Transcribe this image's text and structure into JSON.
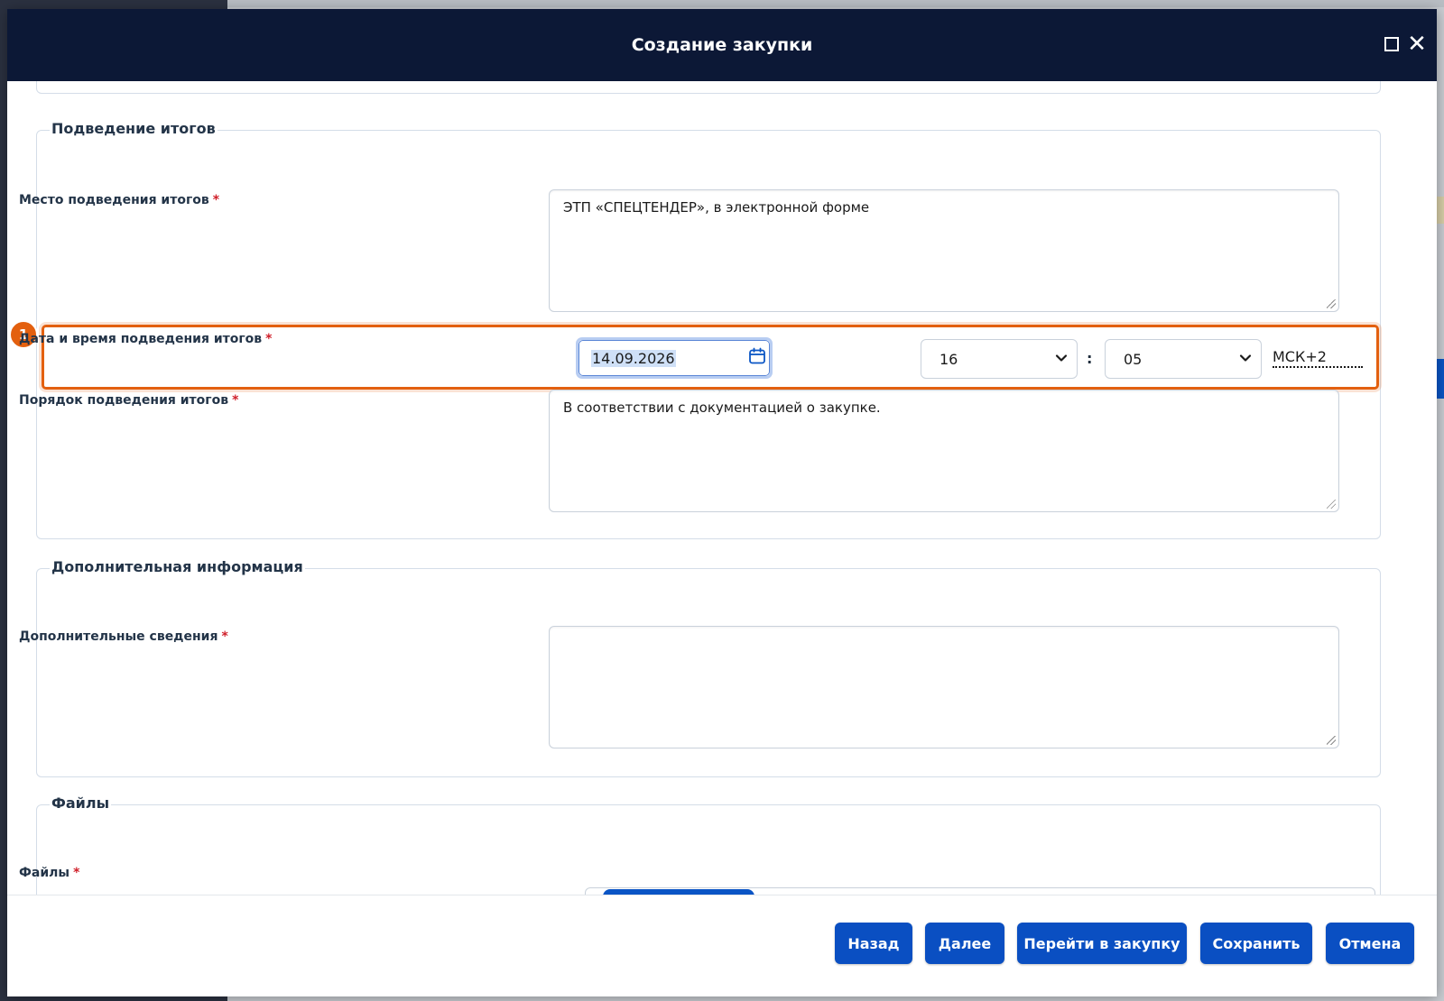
{
  "modal": {
    "title": "Создание закупки",
    "maximize_icon": "maximize-icon",
    "close_icon": "close-icon"
  },
  "summary_section": {
    "legend": "Подведение итогов",
    "place": {
      "label": "Место подведения итогов",
      "required": "*",
      "value": "ЭТП «СПЕЦТЕНДЕР», в электронной форме"
    },
    "datetime": {
      "label": "Дата и время подведения итогов",
      "required": "*",
      "date": "14.09.2026",
      "hour": "16",
      "separator": ":",
      "minute": "05",
      "timezone": "МСК+2",
      "highlight_badge": "1"
    },
    "procedure": {
      "label": "Порядок подведения итогов",
      "required": "*",
      "value": "В соответствии с документацией о закупке."
    }
  },
  "extra_section": {
    "legend": "Дополнительная информация",
    "details": {
      "label": "Дополнительные сведения",
      "required": "*",
      "value": ""
    }
  },
  "files_section": {
    "legend": "Файлы",
    "files": {
      "label": "Файлы",
      "required": "*"
    }
  },
  "footer": {
    "back": "Назад",
    "next": "Далее",
    "go_to_purchase": "Перейти в закупку",
    "save": "Сохранить",
    "cancel": "Отмена"
  },
  "colors": {
    "header_bg": "#0c1836",
    "button_bg": "#0a4fc2",
    "highlight": "#e3600f",
    "required": "#d0202a"
  }
}
